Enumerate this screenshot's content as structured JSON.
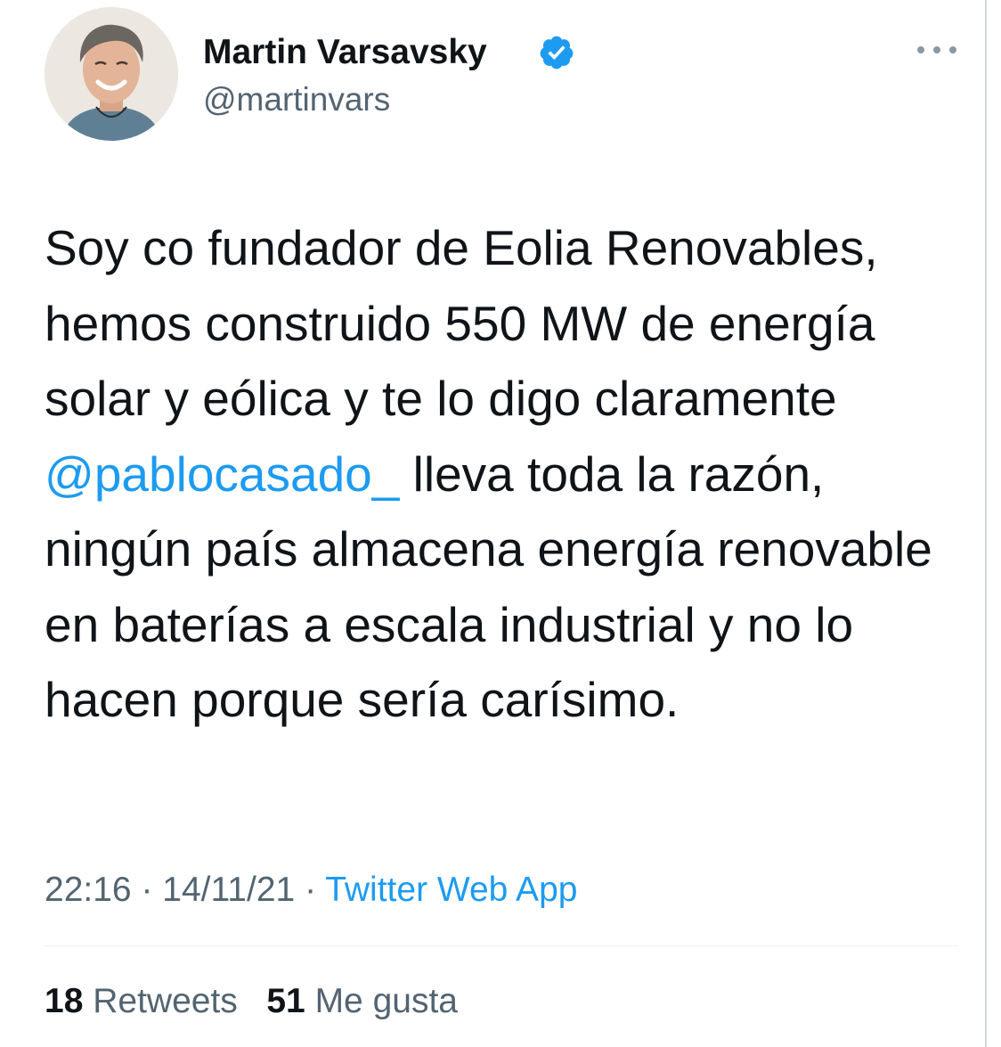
{
  "author": {
    "name": "Martin Varsavsky",
    "handle": "@martinvars",
    "verified": true
  },
  "tweet": {
    "text_before": "Soy co fundador de Eolia Renovables, hemos construido 550 MW de energía solar y eólica y te lo digo claramente ",
    "mention": "@pablocasado_",
    "text_after": " lleva toda la razón, ningún país almacena energía renovable en baterías a escala industrial y no lo hacen porque sería carísimo."
  },
  "meta": {
    "time": "22:16",
    "separator": "·",
    "date": "14/11/21",
    "source": "Twitter Web App"
  },
  "stats": {
    "retweets_count": "18",
    "retweets_label": "Retweets",
    "likes_count": "51",
    "likes_label": "Me gusta"
  },
  "colors": {
    "accent": "#1d9bf0",
    "secondary_text": "#536471",
    "primary_text": "#0f1419"
  },
  "icons": {
    "verified": "verified-badge-icon",
    "more": "more-options-icon"
  }
}
